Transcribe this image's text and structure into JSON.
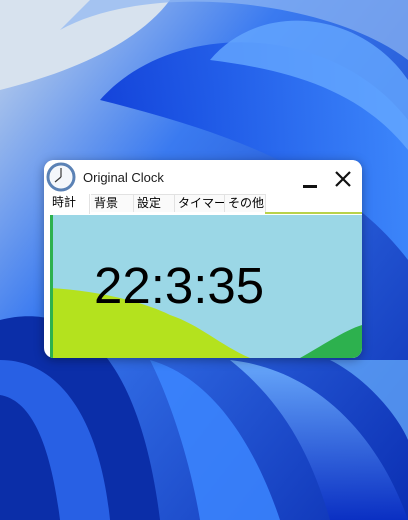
{
  "window": {
    "title": "Original Clock"
  },
  "tabs": [
    {
      "label": "時計",
      "active": true
    },
    {
      "label": "背景",
      "active": false
    },
    {
      "label": "設定",
      "active": false
    },
    {
      "label": "タイマー",
      "active": false
    },
    {
      "label": "その他",
      "active": false
    }
  ],
  "clock": {
    "time": "22:3:35"
  },
  "colors": {
    "sky": "#9bd7e6",
    "hill_yellow_green": "#b4e21e",
    "hill_green": "#2db14e",
    "desktop_blue": "#1a4fd6"
  }
}
